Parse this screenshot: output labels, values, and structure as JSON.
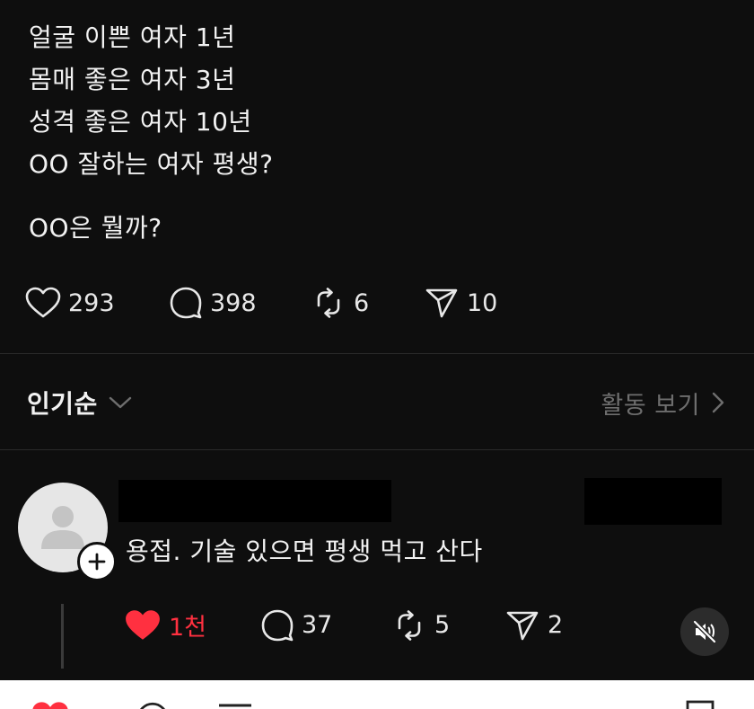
{
  "post": {
    "lines": [
      "얼굴 이쁜 여자 1년",
      "몸매 좋은 여자 3년",
      "성격 좋은 여자 10년",
      "OO 잘하는 여자 평생?"
    ],
    "question": "OO은 뭘까?",
    "stats": {
      "likes": "293",
      "comments": "398",
      "reposts": "6",
      "shares": "10"
    }
  },
  "sort": {
    "label": "인기순",
    "activity_link": "활동 보기"
  },
  "comment": {
    "text": "용접. 기술 있으면 평생 먹고 산다",
    "stats": {
      "likes": "1천",
      "comments": "37",
      "reposts": "5",
      "shares": "2"
    }
  },
  "colors": {
    "background": "#0e0e0e",
    "text": "#f2f2f2",
    "muted": "#6e6e6e",
    "liked_red": "#ff3040",
    "divider": "#2a2a2a"
  },
  "icons": [
    "heart-icon",
    "comment-bubble-icon",
    "repost-icon",
    "share-send-icon",
    "chevron-down-icon",
    "chevron-right-icon",
    "user-placeholder-icon",
    "plus-icon",
    "mute-speaker-icon"
  ]
}
